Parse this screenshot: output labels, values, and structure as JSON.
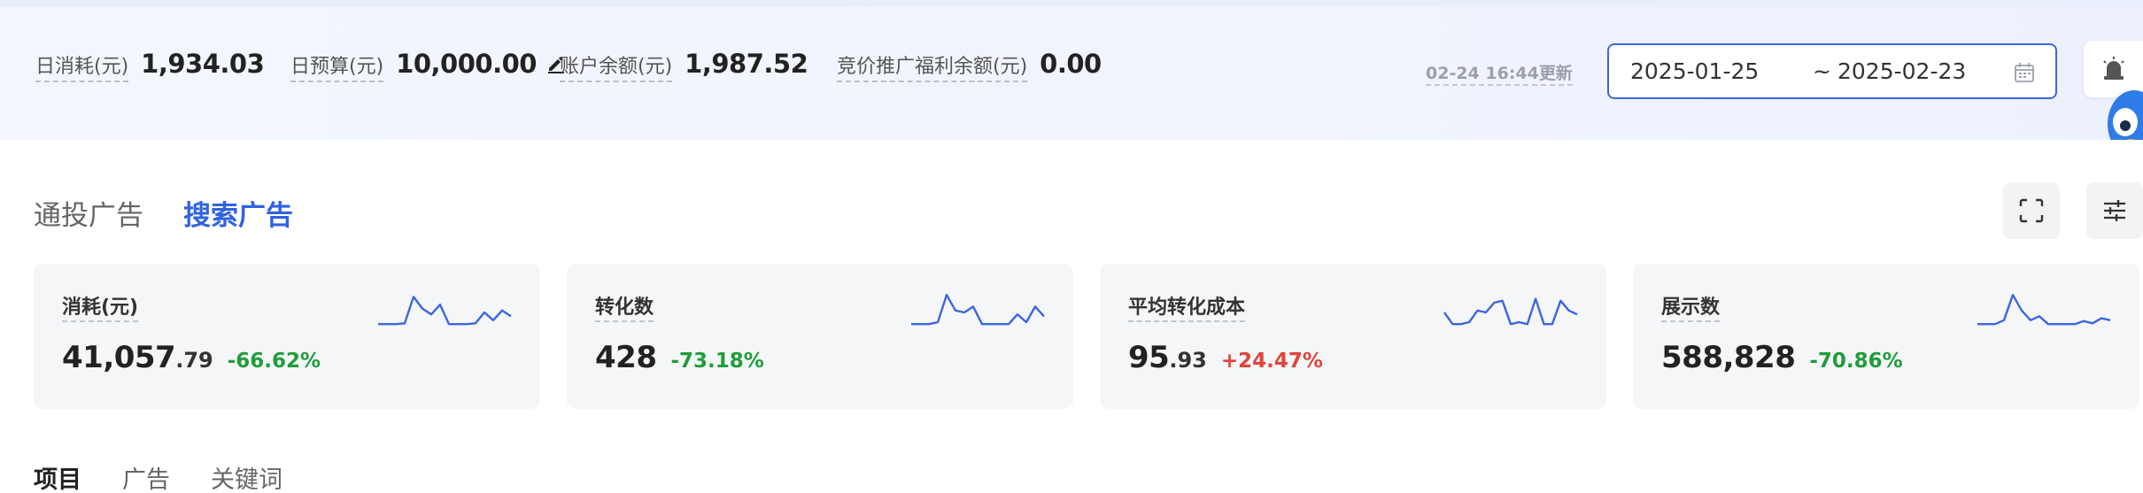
{
  "topbar": {
    "daily_spend": {
      "label": "日消耗(元)",
      "value": "1,934.03"
    },
    "daily_budget": {
      "label": "日预算(元)",
      "value": "10,000.00"
    },
    "account_balance": {
      "label": "账户余额(元)",
      "value": "1,987.52"
    },
    "bid_welfare_balance": {
      "label": "竞价推广福利余额(元)",
      "value": "0.00"
    },
    "updated_text": "02-24 16:44更新",
    "date_range": {
      "start": "2025-01-25",
      "separator": "~",
      "end": "2025-02-23"
    }
  },
  "ad_tabs": [
    {
      "label": "通投广告",
      "active": false
    },
    {
      "label": "搜索广告",
      "active": true
    }
  ],
  "cards": [
    {
      "title": "消耗(元)",
      "int": "41,057",
      "dec": ".79",
      "change": "-66.62%",
      "trend": "down",
      "spark": [
        0.2,
        0.2,
        0.2,
        0.22,
        0.9,
        0.6,
        0.45,
        0.7,
        0.2,
        0.2,
        0.2,
        0.22,
        0.5,
        0.3,
        0.55,
        0.4
      ]
    },
    {
      "title": "转化数",
      "int": "428",
      "dec": "",
      "change": "-73.18%",
      "trend": "down",
      "spark": [
        0.2,
        0.2,
        0.2,
        0.25,
        0.95,
        0.55,
        0.5,
        0.65,
        0.2,
        0.2,
        0.2,
        0.2,
        0.45,
        0.25,
        0.65,
        0.4
      ]
    },
    {
      "title": "平均转化成本",
      "int": "95",
      "dec": ".93",
      "change": "+24.47%",
      "trend": "up",
      "spark": [
        0.5,
        0.2,
        0.2,
        0.25,
        0.55,
        0.5,
        0.75,
        0.8,
        0.2,
        0.25,
        0.2,
        0.85,
        0.2,
        0.2,
        0.8,
        0.55,
        0.45
      ]
    },
    {
      "title": "展示数",
      "int": "588,828",
      "dec": "",
      "change": "-70.86%",
      "trend": "down",
      "spark": [
        0.2,
        0.2,
        0.2,
        0.3,
        0.95,
        0.55,
        0.3,
        0.4,
        0.2,
        0.2,
        0.2,
        0.2,
        0.28,
        0.22,
        0.35,
        0.3
      ]
    }
  ],
  "sub_tabs": [
    {
      "label": "项目",
      "active": true
    },
    {
      "label": "广告",
      "active": false
    },
    {
      "label": "关键词",
      "active": false
    }
  ],
  "colors": {
    "accent": "#3163e0",
    "spark": "#3b66e0",
    "down": "#1f9d3a",
    "up": "#e0443b"
  }
}
